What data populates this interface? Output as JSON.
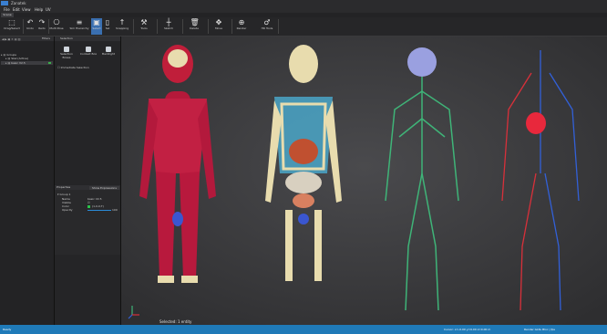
{
  "app": {
    "title": "Zanatek"
  },
  "menu": [
    "File",
    "Edit",
    "View",
    "Help",
    "UV"
  ],
  "tab": "Scene",
  "ribbon": [
    {
      "label": "Drag/Select",
      "icon": "⬚"
    },
    {
      "label": "Undo",
      "icon": "↶"
    },
    {
      "label": "Redo",
      "icon": "↷"
    },
    {
      "label": "Multi Pose",
      "icon": "⎔"
    },
    {
      "label": "Sim Hierarchy",
      "icon": "≡"
    },
    {
      "label": "Select",
      "icon": "▣"
    },
    {
      "label": "Sel",
      "icon": "▯"
    },
    {
      "label": "Snapping",
      "icon": "↑"
    },
    {
      "label": "Tools",
      "icon": "⚒"
    },
    {
      "label": "Sketch",
      "icon": "┼"
    },
    {
      "label": "Delete",
      "icon": "🗑"
    },
    {
      "label": "Move",
      "icon": "✥"
    },
    {
      "label": "Render",
      "icon": "⊕"
    },
    {
      "label": "HR Tools",
      "icon": "♂"
    }
  ],
  "left_panel": {
    "header": "Filters",
    "tree": [
      "Groups",
      "Skel (Active)",
      "basic V2.5"
    ]
  },
  "selection_panel": {
    "title": "Selection",
    "buttons": [
      "Selection Boxes",
      "Context Box",
      "Backlight"
    ],
    "checkbox": "Immediate Selection"
  },
  "properties": {
    "title": "Properties",
    "button": "Show Expressions",
    "group": "Group 1",
    "rows": [
      {
        "label": "Name",
        "value": "basic V2.5"
      },
      {
        "label": "Visible",
        "value": "☑"
      },
      {
        "label": "Color",
        "value": "(1,0,0,T)"
      },
      {
        "label": "Opacity",
        "value": "100"
      }
    ]
  },
  "viewport": {
    "selection_info": "Selected: 1 entity"
  },
  "status": {
    "left": "Ready",
    "center": "Cursor: x=-0.00 y=0.00 z=0.00 m",
    "right": "Render GLSL Bloc | fps"
  },
  "colors": {
    "accent": "#1f7ab8",
    "muscle": "#c01e3a",
    "bone": "#e8dcae",
    "nerve": "#3fb478",
    "artery": "#d8303a",
    "vein": "#3260d8"
  }
}
